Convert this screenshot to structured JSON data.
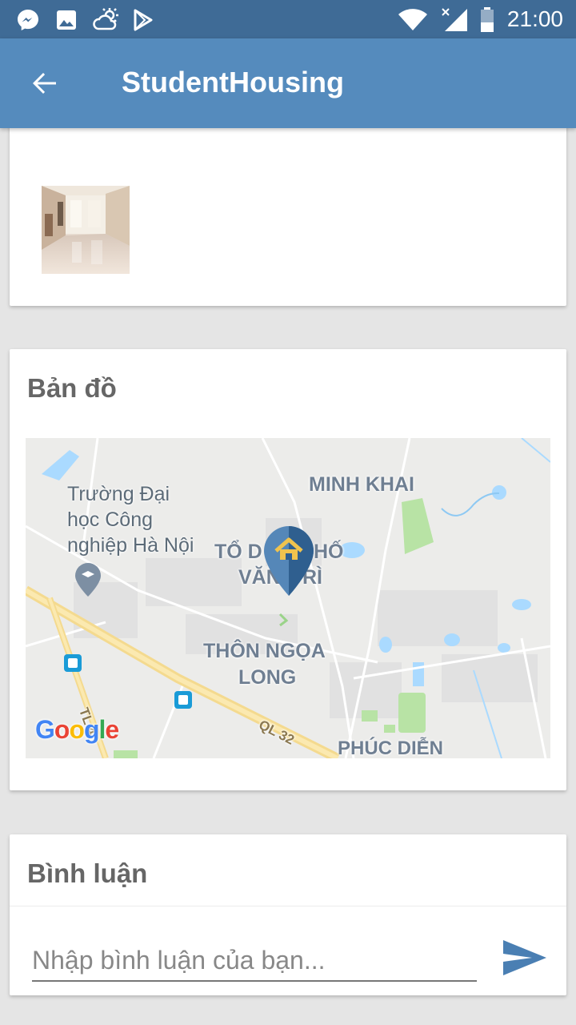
{
  "status_bar": {
    "time": "21:00",
    "left_icons": [
      "messenger-icon",
      "image-icon",
      "weather-icon",
      "play-store-icon"
    ],
    "right_icons": [
      "wifi-icon",
      "cellular-signal-icon",
      "battery-icon"
    ]
  },
  "app_bar": {
    "title": "StudentHousing",
    "back_icon": "arrow-back-icon"
  },
  "photos": {
    "thumbnail_icon": "room-photo"
  },
  "map_section": {
    "title": "Bản đồ",
    "labels": {
      "minh_khai": "MINH KHAI",
      "to_dan_pho_1": "TỔ D",
      "to_dan_pho_2": "HỐ",
      "van_tri_1": "VĂN",
      "van_tri_2": "RÌ",
      "thon_ngoa_long_1": "THÔN NGỌA",
      "thon_ngoa_long_2": "LONG",
      "phuc_dien": "PHÚC DIỄN",
      "road_ql32": "QL 32",
      "road_tl": "TL 4",
      "university_line1": "Trường Đại",
      "university_line2": "học Công",
      "university_line3": "nghiệp Hà Nội"
    },
    "google_logo": "Google"
  },
  "comments": {
    "title": "Bình luận",
    "input_placeholder": "Nhập bình luận của bạn...",
    "input_value": "",
    "send_icon": "send-icon"
  },
  "colors": {
    "status_bar": "#3f6b96",
    "app_bar": "#558bbd",
    "accent": "#4a7fb3",
    "background": "#e5e5e5"
  }
}
